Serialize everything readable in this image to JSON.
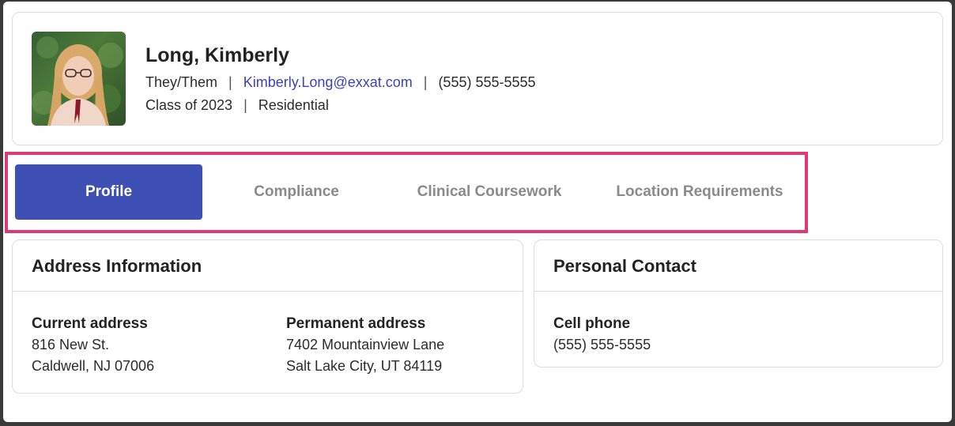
{
  "profile": {
    "name": "Long, Kimberly",
    "pronouns": "They/Them",
    "email": "Kimberly.Long@exxat.com",
    "phone": "(555) 555-5555",
    "class_year": "Class of 2023",
    "program_type": "Residential",
    "separator": "|"
  },
  "tabs": [
    {
      "label": "Profile",
      "active": true
    },
    {
      "label": "Compliance",
      "active": false
    },
    {
      "label": "Clinical Coursework",
      "active": false
    },
    {
      "label": "Location Requirements",
      "active": false
    }
  ],
  "address_panel": {
    "title": "Address Information",
    "current": {
      "label": "Current address",
      "line1": "816 New St.",
      "line2": "Caldwell, NJ 07006"
    },
    "permanent": {
      "label": "Permanent address",
      "line1": "7402 Mountainview Lane",
      "line2": "Salt Lake City, UT 84119"
    }
  },
  "contact_panel": {
    "title": "Personal Contact",
    "cell": {
      "label": "Cell phone",
      "value": "(555) 555-5555"
    }
  },
  "colors": {
    "accent": "#3f50b5",
    "highlight": "#e0397a",
    "link": "#3a44b5"
  }
}
